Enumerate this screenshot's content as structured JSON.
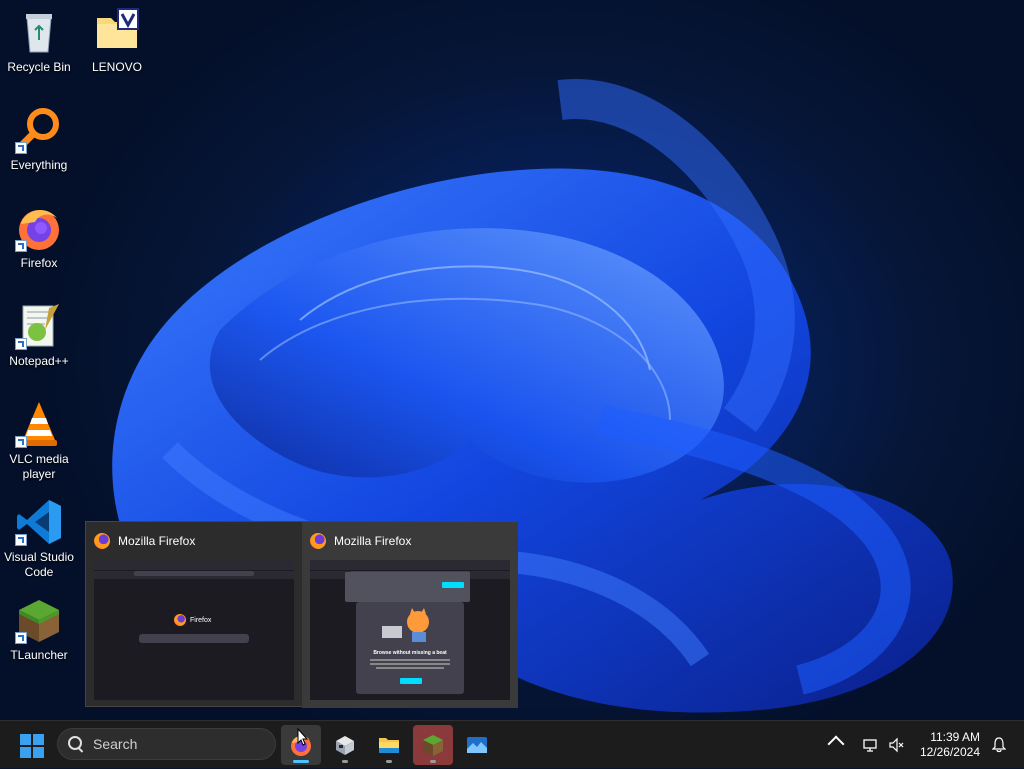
{
  "desktop": {
    "icons": [
      {
        "label": "Recycle Bin",
        "icon": "recycle-bin-icon",
        "shortcut": false
      },
      {
        "label": "LENOVO",
        "icon": "folder-icon",
        "shortcut": false
      },
      {
        "label": "Everything",
        "icon": "everything-search-icon",
        "shortcut": true
      },
      {
        "label": "Firefox",
        "icon": "firefox-icon",
        "shortcut": true
      },
      {
        "label": "Notepad++",
        "icon": "notepad-plus-plus-icon",
        "shortcut": true
      },
      {
        "label": "VLC media player",
        "icon": "vlc-icon",
        "shortcut": true
      },
      {
        "label": "Visual Studio Code",
        "icon": "vscode-icon",
        "shortcut": true
      },
      {
        "label": "TLauncher",
        "icon": "tlauncher-icon",
        "shortcut": true
      }
    ]
  },
  "preview": {
    "windows": [
      {
        "title": "Mozilla Firefox",
        "content_brand": "Firefox"
      },
      {
        "title": "Mozilla Firefox",
        "dialog_heading": "Browse without missing a beat"
      }
    ]
  },
  "taskbar": {
    "search_placeholder": "Search",
    "apps": [
      {
        "name": "firefox",
        "active": true
      },
      {
        "name": "virtualbox",
        "active": false
      },
      {
        "name": "file-explorer",
        "active": false
      },
      {
        "name": "tlauncher",
        "active": true
      },
      {
        "name": "image-viewer",
        "active": false
      }
    ],
    "time": "11:39 AM",
    "date": "12/26/2024"
  },
  "colors": {
    "accent": "#4cc2ff",
    "start": "#3aa0f0",
    "taskbar_bg": "#1c1c1c"
  }
}
